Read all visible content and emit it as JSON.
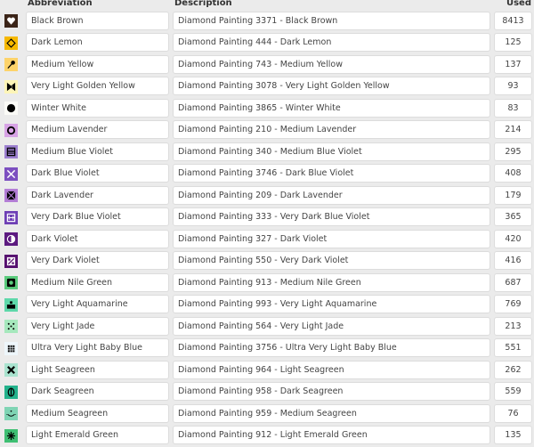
{
  "headers": {
    "abbreviation": "Abbreviation",
    "description": "Description",
    "used": "Used"
  },
  "rows": [
    {
      "abbreviation": "Black Brown",
      "description": "Diamond Painting 3371 - Black Brown",
      "used": "8413",
      "swatch_color": "#3b2418",
      "symbol": "heart-down",
      "symbol_color": "#ffffff"
    },
    {
      "abbreviation": "Dark Lemon",
      "description": "Diamond Painting 444 - Dark Lemon",
      "used": "125",
      "swatch_color": "#f5b800",
      "symbol": "diamond-outline",
      "symbol_color": "#000000"
    },
    {
      "abbreviation": "Medium Yellow",
      "description": "Diamond Painting 743 - Medium Yellow",
      "used": "137",
      "swatch_color": "#fdd36a",
      "symbol": "pin",
      "symbol_color": "#000000"
    },
    {
      "abbreviation": "Very Light Golden Yellow",
      "description": "Diamond Painting 3078 - Very Light Golden Yellow",
      "used": "93",
      "swatch_color": "#fdf5b8",
      "symbol": "bowtie",
      "symbol_color": "#000000"
    },
    {
      "abbreviation": "Winter White",
      "description": "Diamond Painting 3865 - Winter White",
      "used": "83",
      "swatch_color": "#fbfbf7",
      "symbol": "dot",
      "symbol_color": "#000000"
    },
    {
      "abbreviation": "Medium Lavender",
      "description": "Diamond Painting 210 - Medium Lavender",
      "used": "214",
      "swatch_color": "#d7a3e5",
      "symbol": "ring",
      "symbol_color": "#000000"
    },
    {
      "abbreviation": "Medium Blue Violet",
      "description": "Diamond Painting 340 - Medium Blue Violet",
      "used": "295",
      "swatch_color": "#9d80d0",
      "symbol": "striped-square",
      "symbol_color": "#000000"
    },
    {
      "abbreviation": "Dark Blue Violet",
      "description": "Diamond Painting 3746 - Dark Blue Violet",
      "used": "408",
      "swatch_color": "#7c4fc0",
      "symbol": "cross",
      "symbol_color": "#ffffff"
    },
    {
      "abbreviation": "Dark Lavender",
      "description": "Diamond Painting 209 - Dark Lavender",
      "used": "179",
      "swatch_color": "#b47ed6",
      "symbol": "square-x",
      "symbol_color": "#000000"
    },
    {
      "abbreviation": "Very Dark Blue Violet",
      "description": "Diamond Painting 333 - Very Dark Blue Violet",
      "used": "365",
      "swatch_color": "#6e3fb5",
      "symbol": "split-box",
      "symbol_color": "#ffffff"
    },
    {
      "abbreviation": "Dark Violet",
      "description": "Diamond Painting 327 - Dark Violet",
      "used": "420",
      "swatch_color": "#5c1a80",
      "symbol": "half-circle",
      "symbol_color": "#ffffff"
    },
    {
      "abbreviation": "Very Dark Violet",
      "description": "Diamond Painting 550 - Very Dark Violet",
      "used": "416",
      "swatch_color": "#56106f",
      "symbol": "percent-box",
      "symbol_color": "#ffffff"
    },
    {
      "abbreviation": "Medium Nile Green",
      "description": "Diamond Painting 913 - Medium Nile Green",
      "used": "687",
      "swatch_color": "#5acb7c",
      "symbol": "square-ring",
      "symbol_color": "#000000"
    },
    {
      "abbreviation": "Very Light Aquamarine",
      "description": "Diamond Painting 993 - Very Light Aquamarine",
      "used": "769",
      "swatch_color": "#5ed8aa",
      "symbol": "podium",
      "symbol_color": "#000000"
    },
    {
      "abbreviation": "Very Light Jade",
      "description": "Diamond Painting 564 - Very Light Jade",
      "used": "213",
      "swatch_color": "#a6e8bd",
      "symbol": "five-dots",
      "symbol_color": "#000000"
    },
    {
      "abbreviation": "Ultra Very Light Baby Blue",
      "description": "Diamond Painting 3756 - Ultra Very Light Baby Blue",
      "used": "551",
      "swatch_color": "#eef6fb",
      "symbol": "grid-dots",
      "symbol_color": "#000000"
    },
    {
      "abbreviation": "Light Seagreen",
      "description": "Diamond Painting 964 - Light Seagreen",
      "used": "262",
      "swatch_color": "#a9e3cf",
      "symbol": "bold-x",
      "symbol_color": "#000000"
    },
    {
      "abbreviation": "Dark Seagreen",
      "description": "Diamond Painting 958 - Dark Seagreen",
      "used": "559",
      "swatch_color": "#23b28c",
      "symbol": "phi",
      "symbol_color": "#000000"
    },
    {
      "abbreviation": "Medium Seagreen",
      "description": "Diamond Painting 959 - Medium Seagreen",
      "used": "76",
      "swatch_color": "#7fd4b4",
      "symbol": "smile",
      "symbol_color": "#000000"
    },
    {
      "abbreviation": "Light Emerald Green",
      "description": "Diamond Painting 912 - Light Emerald Green",
      "used": "135",
      "swatch_color": "#3fbf73",
      "symbol": "asterisk",
      "symbol_color": "#000000"
    }
  ]
}
